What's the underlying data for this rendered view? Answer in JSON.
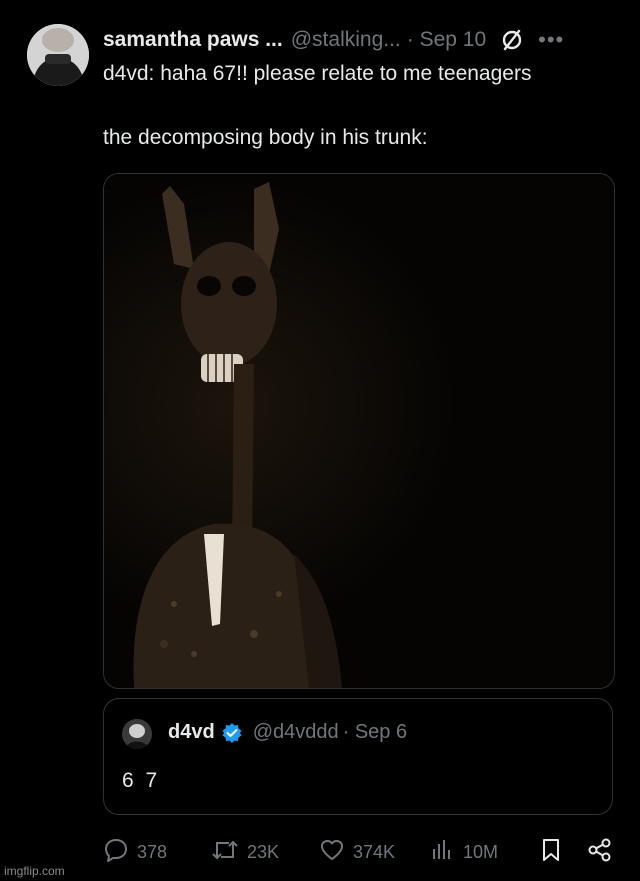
{
  "tweet": {
    "author_name": "samantha paws ...",
    "handle": "@stalking...",
    "date": "· Sep 10",
    "icons": [
      "no-sign-icon",
      "more-icon"
    ],
    "more_label": "•••",
    "text_line1": "d4vd: haha 67!! please relate to me teenagers",
    "text_line2": "the decomposing body in his trunk:"
  },
  "quote": {
    "name": "d4vd",
    "verified_icon": "verified-badge-icon",
    "handle": "@d4vddd",
    "date": "· Sep 6",
    "text": "6 7"
  },
  "actions": {
    "replies": "378",
    "reposts": "23K",
    "likes": "374K",
    "views": "10M",
    "icons": [
      "reply-icon",
      "repost-icon",
      "like-icon",
      "views-icon",
      "bookmark-icon",
      "share-icon"
    ]
  },
  "colors": {
    "background": "#000000",
    "text": "#e7e9ea",
    "muted": "#71767b",
    "border": "#2f3336",
    "verified": "#1d9bf0"
  },
  "watermark": "imgflip.com"
}
